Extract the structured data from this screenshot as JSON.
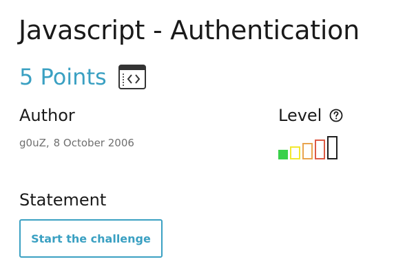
{
  "challenge": {
    "title": "Javascript - Authentication",
    "points": "5 Points",
    "category_icon": "code-window-icon"
  },
  "author": {
    "label": "Author",
    "name": "g0uZ,",
    "date": "8 October 2006"
  },
  "level": {
    "label": "Level",
    "help_icon": "question-circle-icon",
    "value": 1,
    "max": 5,
    "colors": [
      "#3ad14a",
      "#f2e830",
      "#e8a34c",
      "#dc5a44",
      "#1f1f1f"
    ]
  },
  "statement": {
    "label": "Statement",
    "button_label": "Start the challenge"
  },
  "colors": {
    "accent": "#3aa0c2",
    "text": "#1a1a1a",
    "muted": "#6f6f6f"
  }
}
